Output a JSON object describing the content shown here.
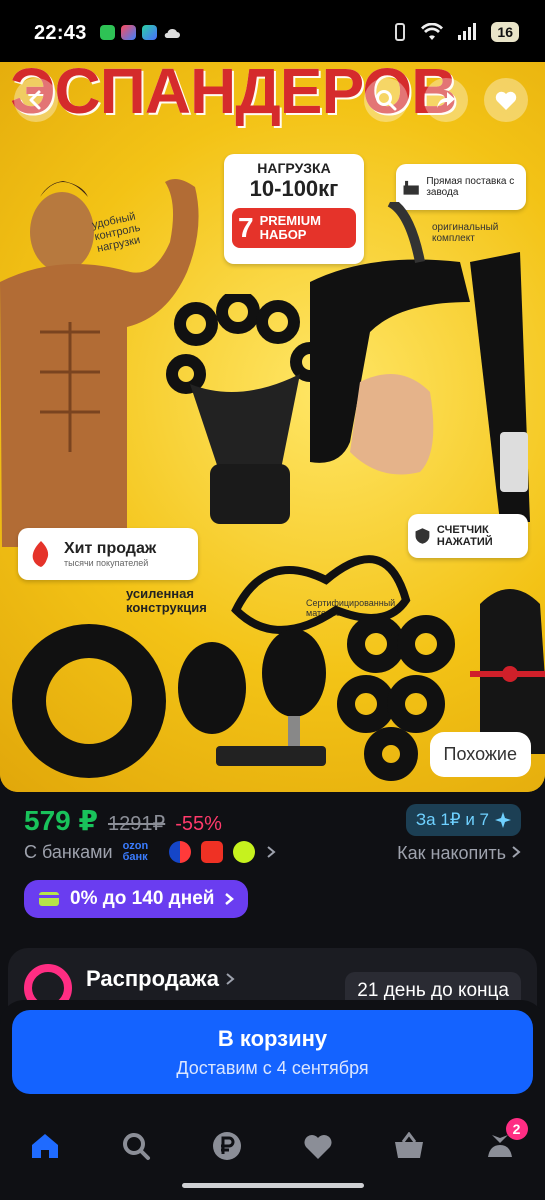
{
  "status_bar": {
    "time": "22:43",
    "battery": "16"
  },
  "hero": {
    "banner_text": "ЭСПАНДЕРОВ",
    "load_label": "НАГРУЗКА",
    "load_range": "10-100кг",
    "set_number": "7",
    "set_label": "PREMIUM НАБОР",
    "direct_supply": "Прямая поставка с завода",
    "original_kit": "оригинальный комплект",
    "load_control": "удобный контроль нагрузки",
    "hit_label": "Хит продаж",
    "hit_sub": "тысячи покупателей",
    "counter_label": "СЧЕТЧИК НАЖАТИЙ",
    "reinforced_label": "усиленная конструкция",
    "certified_label": "Сертифицированный материал",
    "similar_button": "Похожие"
  },
  "price": {
    "current": "579 ₽",
    "old": "1291₽",
    "discount": "-55%",
    "points_label": "За 1₽ и 7"
  },
  "banks": {
    "label": "С банками",
    "ozon_bank": "ozon банк",
    "howto": "Как накопить"
  },
  "installment": {
    "label": "0% до 140 дней"
  },
  "sale": {
    "title": "Распродажа",
    "days_left": "21 день до конца"
  },
  "cart": {
    "title": "В корзину",
    "delivery": "Доставим с 4 сентября"
  },
  "nav": {
    "cart_badge": "2"
  },
  "colors": {
    "price_green": "#19c35b",
    "discount_pink": "#ff3a6b",
    "cart_blue": "#1463ff",
    "installment_purple": "#6a3df0",
    "hero_yellow": "#f4c417"
  }
}
